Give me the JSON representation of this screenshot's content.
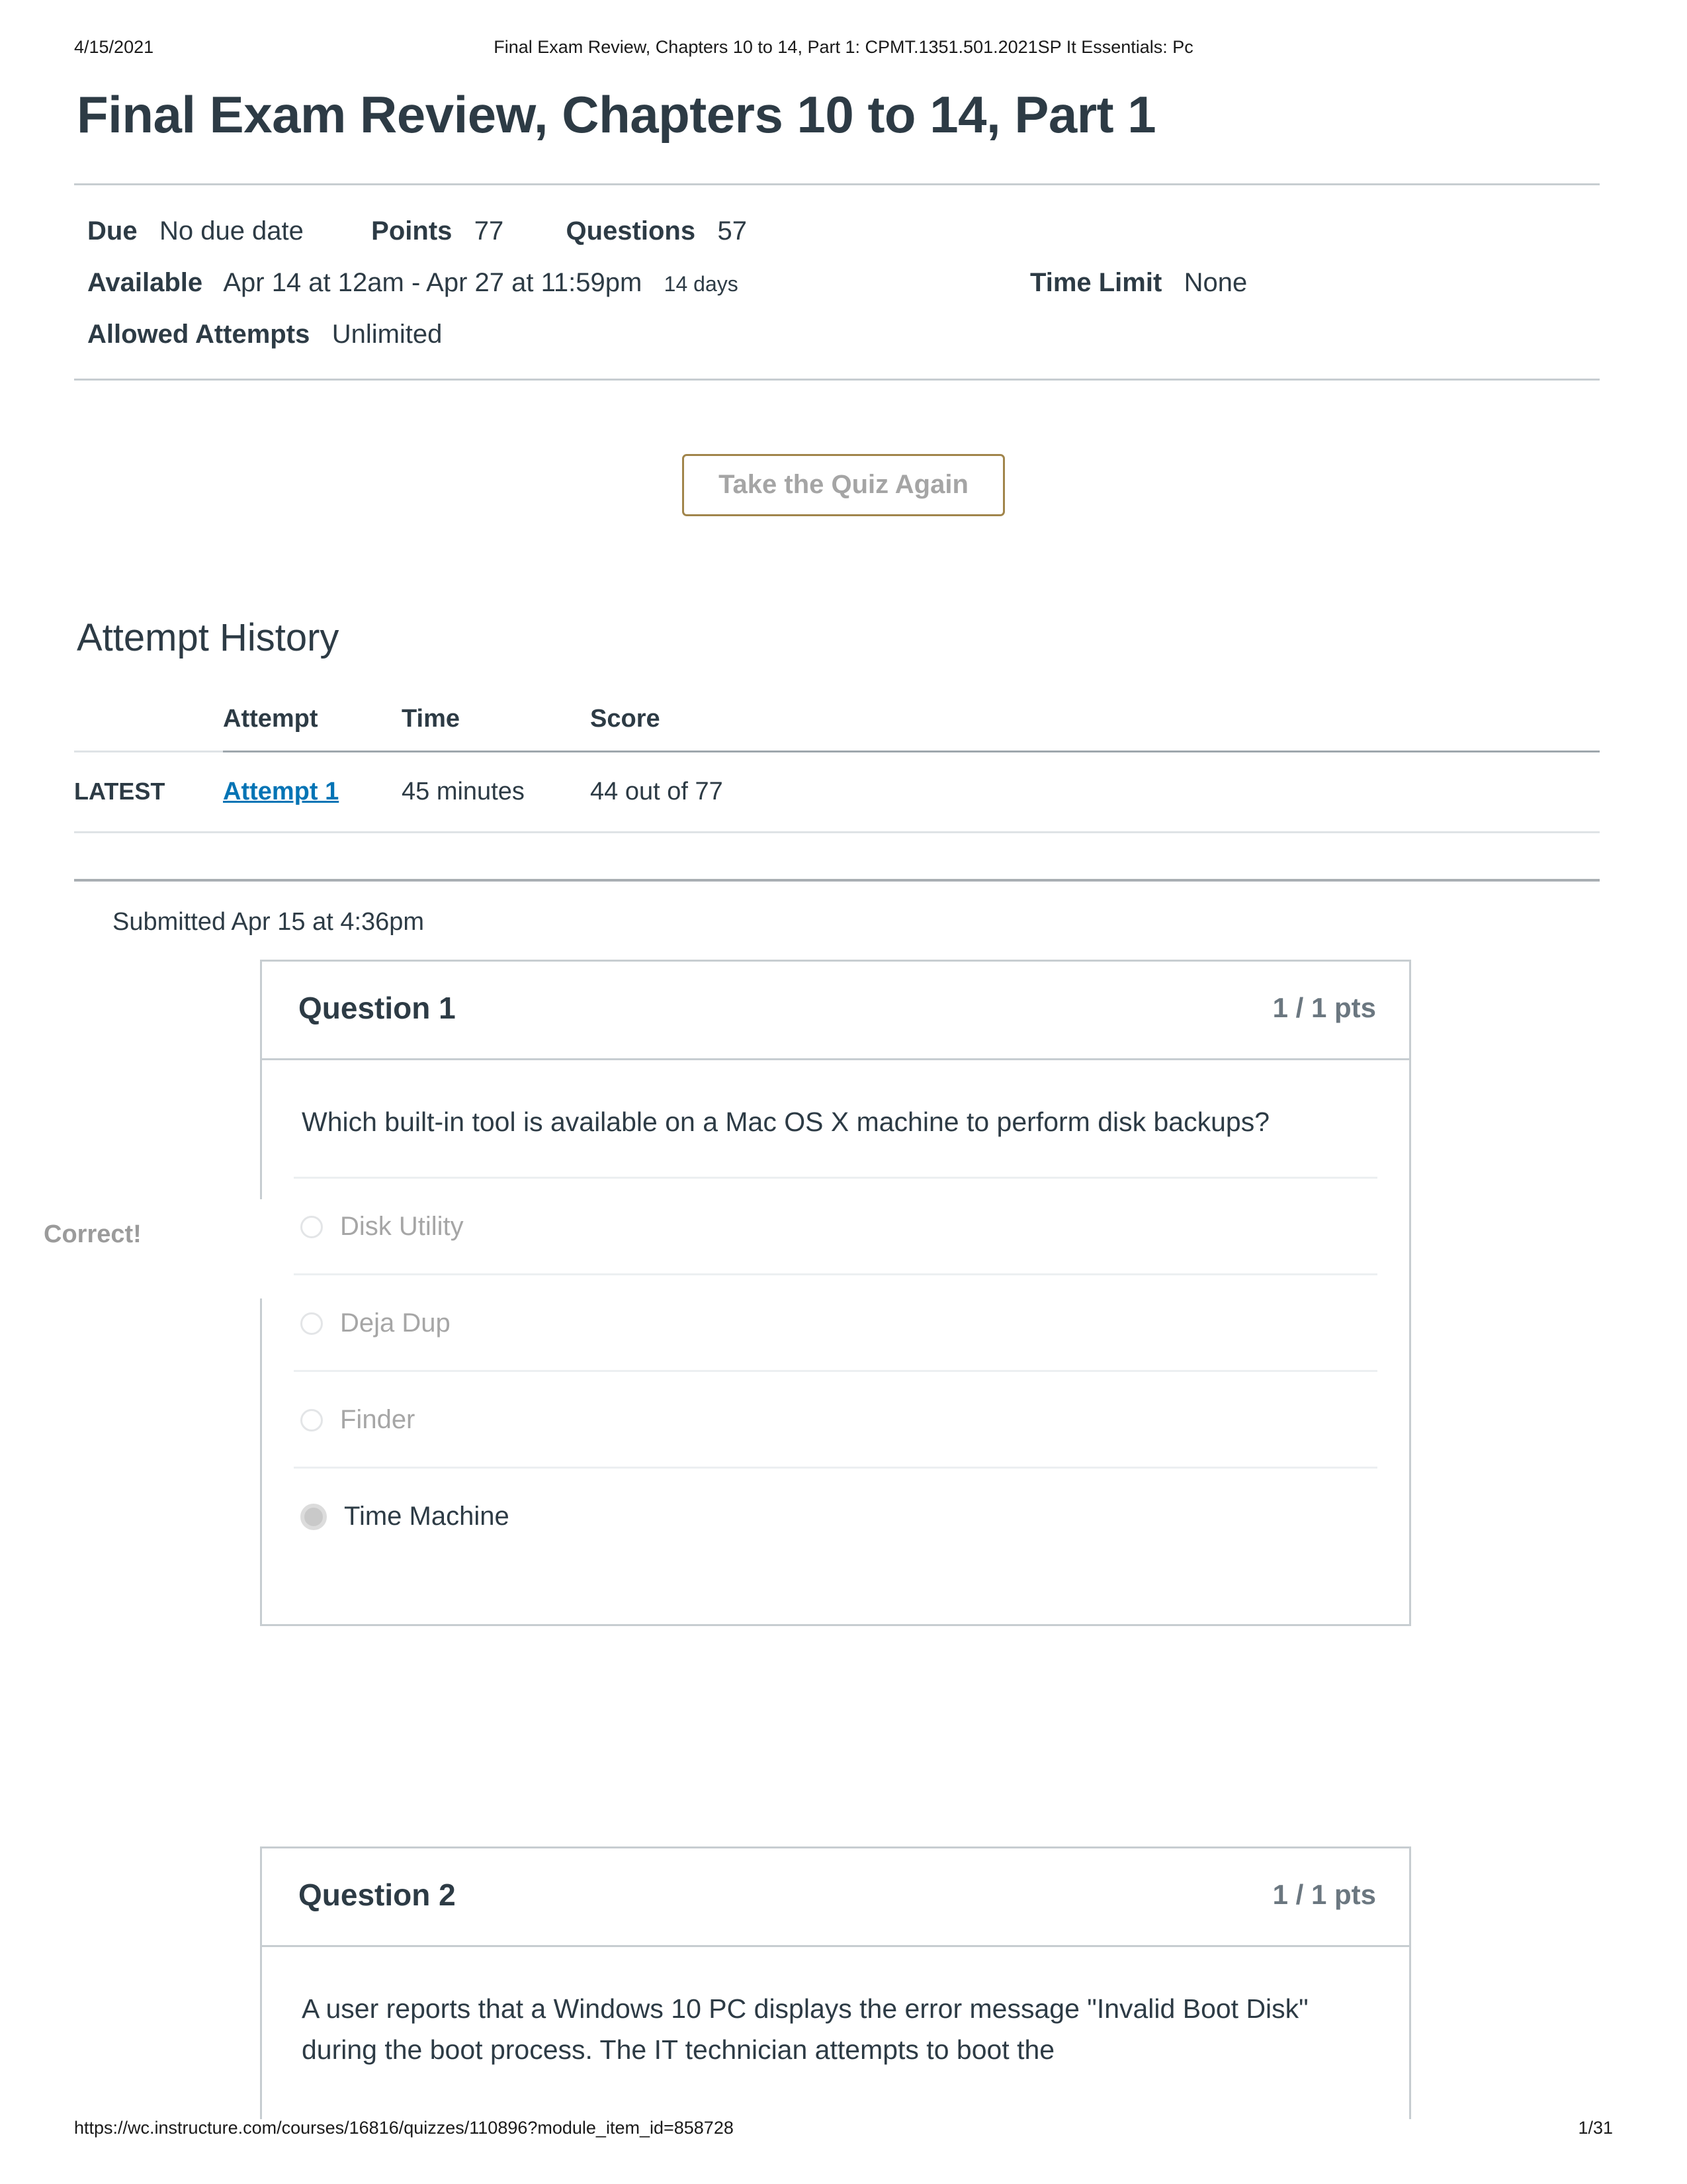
{
  "print_header": {
    "date": "4/15/2021",
    "title": "Final Exam Review, Chapters 10 to 14, Part 1: CPMT.1351.501.2021SP It Essentials: Pc"
  },
  "page_title": "Final Exam Review, Chapters 10 to 14, Part 1",
  "quiz_info": {
    "due_label": "Due",
    "due_value": "No due date",
    "points_label": "Points",
    "points_value": "77",
    "questions_label": "Questions",
    "questions_value": "57",
    "available_label": "Available",
    "available_value": "Apr 14 at 12am - Apr 27 at 11:59pm",
    "available_duration": "14 days",
    "time_limit_label": "Time Limit",
    "time_limit_value": "None",
    "allowed_attempts_label": "Allowed Attempts",
    "allowed_attempts_value": "Unlimited"
  },
  "retake_button": "Take the Quiz Again",
  "attempt_history": {
    "heading": "Attempt History",
    "columns": [
      "",
      "Attempt",
      "Time",
      "Score"
    ],
    "rows": [
      {
        "tag": "LATEST",
        "attempt": "Attempt 1",
        "time": "45 minutes",
        "score": "44 out of 77"
      }
    ]
  },
  "submitted": "Submitted Apr 15 at 4:36pm",
  "questions": [
    {
      "name": "Question 1",
      "points": "1 / 1 pts",
      "text": "Which built-in tool is available on a Mac OS X machine to perform disk backups?",
      "status": "Correct!",
      "answers": [
        {
          "label": "Disk Utility",
          "selected": false
        },
        {
          "label": "Deja Dup",
          "selected": false
        },
        {
          "label": "Finder",
          "selected": false
        },
        {
          "label": "Time Machine",
          "selected": true
        }
      ]
    },
    {
      "name": "Question 2",
      "points": "1 / 1 pts",
      "text": "A user reports that a Windows 10 PC displays the error message \"Invalid Boot Disk\" during the boot process. The IT technician attempts to boot the",
      "status": "",
      "answers": []
    }
  ],
  "footer": {
    "url": "https://wc.instructure.com/courses/16816/quizzes/110896?module_item_id=858728",
    "page": "1/31"
  },
  "colors": {
    "link": "#0374b5",
    "rule": "#c7cdd1",
    "button_border": "#a1854b",
    "muted_text": "#a5a5a5"
  }
}
